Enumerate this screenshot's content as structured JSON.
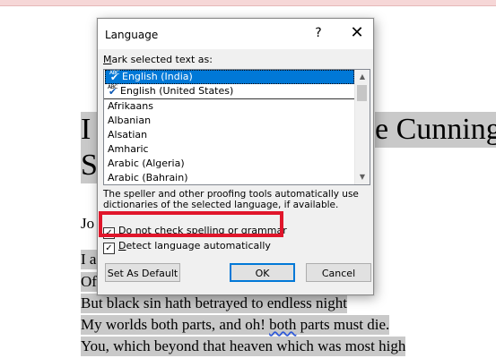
{
  "document": {
    "line_big1_left": "I",
    "line_big1_right": "e Cunning",
    "line_big2": "S",
    "line_author": "Jo",
    "line1": "I a",
    "line2": "Of",
    "line3": "But black sin hath betrayed to endless night",
    "line4_a": "My worlds both parts, and oh! ",
    "line4_b": "both",
    "line4_c": " parts must die.",
    "line5": "You, which beyond that heaven which was most high"
  },
  "dialog": {
    "title": "Language",
    "help_label": "?",
    "close_label": "✕",
    "mark_label_u": "M",
    "mark_label_rest": "ark selected text as:",
    "languages": [
      {
        "label": "English (India)",
        "spell_icon": true
      },
      {
        "label": "English (United States)",
        "spell_icon": true
      },
      {
        "label": "Afrikaans",
        "spell_icon": false
      },
      {
        "label": "Albanian",
        "spell_icon": false
      },
      {
        "label": "Alsatian",
        "spell_icon": false
      },
      {
        "label": "Amharic",
        "spell_icon": false
      },
      {
        "label": "Arabic (Algeria)",
        "spell_icon": false
      },
      {
        "label": "Arabic (Bahrain)",
        "spell_icon": false
      }
    ],
    "selected_language": "English (India)",
    "info_text": "The speller and other proofing tools automatically use dictionaries of the selected language, if available.",
    "no_check_label_u": "D",
    "no_check_label_rest": "o not check spelling or grammar",
    "no_check_checked": true,
    "detect_label_u": "D",
    "detect_label_rest": "etect language automatically",
    "detect_checked": true,
    "set_default_label": "Set As Default",
    "ok_label": "OK",
    "cancel_label": "Cancel"
  },
  "colors": {
    "selection": "#0078d7",
    "highlight_box": "#e0162b",
    "doc_highlight": "#c9c9c9"
  },
  "icons": {
    "spell_check": "abc-checkmark-icon",
    "scroll_up": "chevron-up-icon",
    "scroll_down": "chevron-down-icon",
    "close": "close-icon",
    "help": "help-icon"
  }
}
